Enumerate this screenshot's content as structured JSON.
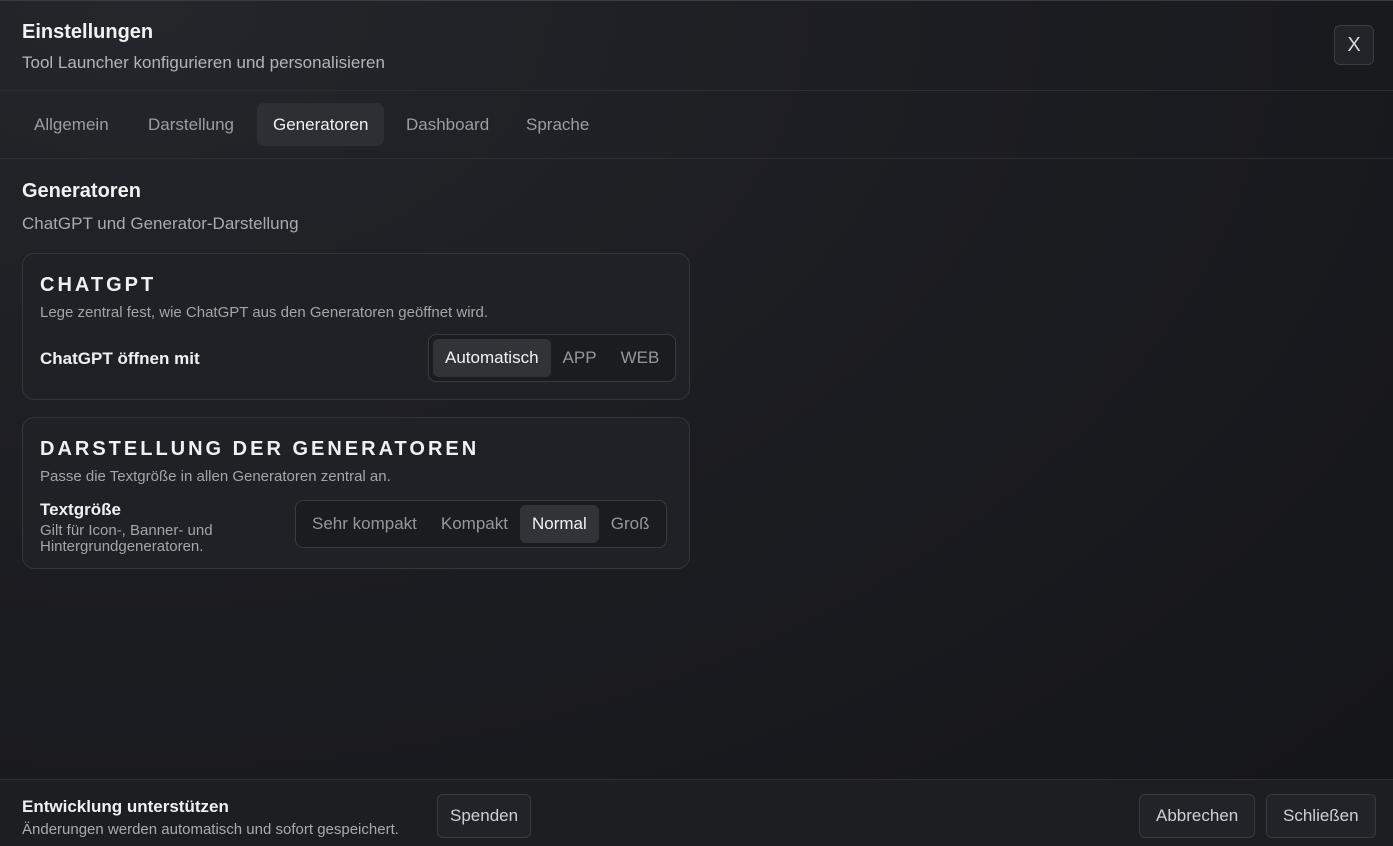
{
  "header": {
    "title": "Einstellungen",
    "subtitle": "Tool Launcher konfigurieren und personalisieren",
    "close_label": "X"
  },
  "tabs": [
    {
      "label": "Allgemein",
      "active": false
    },
    {
      "label": "Darstellung",
      "active": false
    },
    {
      "label": "Generatoren",
      "active": true
    },
    {
      "label": "Dashboard",
      "active": false
    },
    {
      "label": "Sprache",
      "active": false
    }
  ],
  "section": {
    "title": "Generatoren",
    "subtitle": "ChatGPT und Generator-Darstellung"
  },
  "chatgpt_card": {
    "title": "CHATGPT",
    "description": "Lege zentral fest, wie ChatGPT aus den Generatoren geöffnet wird.",
    "row_label": "ChatGPT öffnen mit",
    "options": [
      "Automatisch",
      "APP",
      "WEB"
    ],
    "selected": "Automatisch"
  },
  "generators_card": {
    "title": "DARSTELLUNG DER GENERATOREN",
    "description": "Passe die Textgröße in allen Generatoren zentral an.",
    "row_label": "Textgröße",
    "row_hint": "Gilt für Icon-, Banner- und Hintergrundgeneratoren.",
    "options": [
      "Sehr kompakt",
      "Kompakt",
      "Normal",
      "Groß"
    ],
    "selected": "Normal"
  },
  "footer": {
    "title": "Entwicklung unterstützen",
    "subtitle": "Änderungen werden automatisch und sofort gespeichert.",
    "donate_label": "Spenden",
    "cancel_label": "Abbrechen",
    "close_label": "Schließen"
  },
  "colors": {
    "background": "#1d1e23",
    "card": "#202126",
    "active_segment": "#323338",
    "text_primary": "#f0f0f2",
    "text_secondary": "#a4a5a9"
  }
}
